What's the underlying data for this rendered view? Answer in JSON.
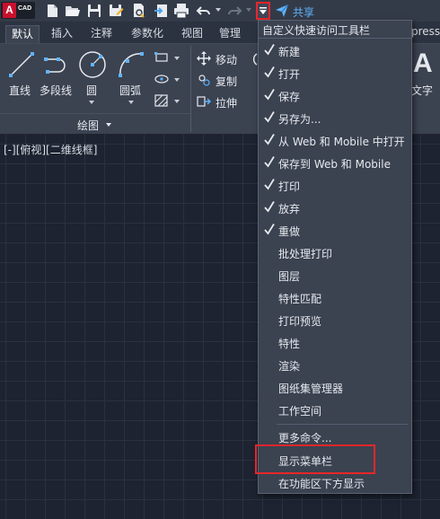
{
  "logo": {
    "letter": "A",
    "product": "CAD"
  },
  "quick_access": {
    "buttons": [
      "new-icon",
      "open-icon",
      "save-icon",
      "save-as-icon",
      "plot-preview-icon",
      "export-icon",
      "print-icon",
      "undo-icon",
      "redo-icon"
    ],
    "share_label": "共享"
  },
  "ribbon": {
    "tabs": [
      "默认",
      "插入",
      "注释",
      "参数化",
      "视图",
      "管理",
      "press"
    ],
    "active_tab": "默认",
    "draw_tools": [
      "直线",
      "多段线",
      "圆",
      "圆弧"
    ],
    "modify_tools": [
      "移动",
      "复制",
      "拉伸"
    ],
    "draw_panel_title": "绘图",
    "right_tool_label": "文字"
  },
  "viewport": {
    "label": "[-][俯视][二维线框]"
  },
  "menu": {
    "title": "自定义快速访问工具栏",
    "items": [
      {
        "label": "新建",
        "checked": true
      },
      {
        "label": "打开",
        "checked": true
      },
      {
        "label": "保存",
        "checked": true
      },
      {
        "label": "另存为...",
        "checked": true
      },
      {
        "label": "从 Web 和 Mobile 中打开",
        "checked": true
      },
      {
        "label": "保存到 Web 和 Mobile",
        "checked": true
      },
      {
        "label": "打印",
        "checked": true
      },
      {
        "label": "放弃",
        "checked": true
      },
      {
        "label": "重做",
        "checked": true
      },
      {
        "label": "批处理打印",
        "checked": false
      },
      {
        "label": "图层",
        "checked": false
      },
      {
        "label": "特性匹配",
        "checked": false
      },
      {
        "label": "打印预览",
        "checked": false
      },
      {
        "label": "特性",
        "checked": false
      },
      {
        "label": "渲染",
        "checked": false
      },
      {
        "label": "图纸集管理器",
        "checked": false
      },
      {
        "label": "工作空间",
        "checked": false
      }
    ],
    "more_commands": "更多命令...",
    "show_menu_bar": "显示菜单栏",
    "show_below_ribbon": "在功能区下方显示"
  },
  "colors": {
    "accent_blue": "#5fb4ff",
    "highlight_red": "#e8262b",
    "logo_red": "#c8102e"
  }
}
